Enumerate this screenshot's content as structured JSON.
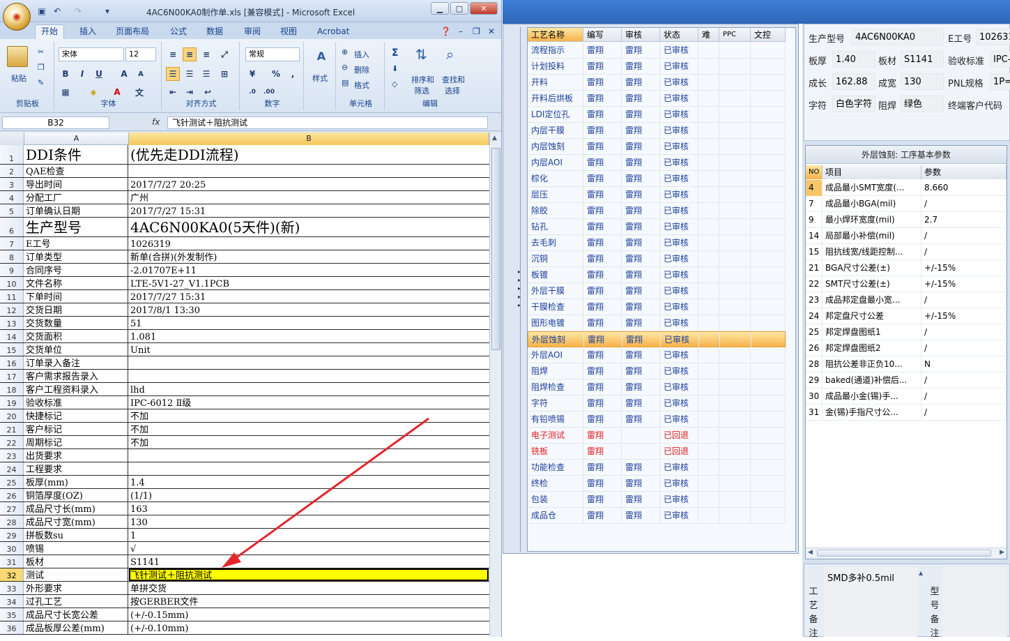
{
  "excel": {
    "window_title": "4AC6N00KA0制作单.xls  [兼容模式] - Microsoft Excel",
    "tabs": [
      "开始",
      "插入",
      "页面布局",
      "公式",
      "数据",
      "审阅",
      "视图",
      "Acrobat"
    ],
    "ribbon": {
      "clipboard": {
        "paste": "粘贴",
        "group": "剪贴板"
      },
      "font": {
        "name": "宋体",
        "size": "12",
        "group": "字体"
      },
      "align": {
        "group": "对齐方式"
      },
      "number": {
        "format": "常规",
        "group": "数字"
      },
      "styles": {
        "label": "样式"
      },
      "cells": {
        "insert": "插入",
        "delete": "删除",
        "format": "格式",
        "group": "单元格"
      },
      "editing": {
        "sort": "排序和",
        "sort2": "筛选",
        "find": "查找和",
        "find2": "选择",
        "group": "编辑"
      }
    },
    "name_box": "B32",
    "fx": "fx",
    "formula": "飞针测试＋阻抗测试",
    "col_a": "A",
    "col_b": "B",
    "rows": [
      {
        "n": "1",
        "a": "DDI条件",
        "b": "(优先走DDI流程)"
      },
      {
        "n": "2",
        "a": "QAE检查",
        "b": ""
      },
      {
        "n": "3",
        "a": "导出时间",
        "b": "2017/7/27 20:25"
      },
      {
        "n": "4",
        "a": "分配工厂",
        "b": "广州"
      },
      {
        "n": "5",
        "a": "订单确认日期",
        "b": "2017/7/27 15:31"
      },
      {
        "n": "6",
        "a": "生产型号",
        "b": "4AC6N00KA0(5天件)(新)"
      },
      {
        "n": "7",
        "a": "E工号",
        "b": "1026319"
      },
      {
        "n": "8",
        "a": "订单类型",
        "b": "新单(合拼)(外发制作)"
      },
      {
        "n": "9",
        "a": "合同序号",
        "b": "-2.01707E+11"
      },
      {
        "n": "10",
        "a": "文件名称",
        "b": "LTE-5V1-27_V1.1PCB"
      },
      {
        "n": "11",
        "a": "下单时间",
        "b": "2017/7/27 15:31"
      },
      {
        "n": "12",
        "a": "交货日期",
        "b": "2017/8/1 13:30"
      },
      {
        "n": "13",
        "a": "交货数量",
        "b": "51"
      },
      {
        "n": "14",
        "a": "交货面积",
        "b": "1.081"
      },
      {
        "n": "15",
        "a": "交货单位",
        "b": "Unit"
      },
      {
        "n": "16",
        "a": "订单录入备注",
        "b": ""
      },
      {
        "n": "17",
        "a": "客户需求报告录入",
        "b": ""
      },
      {
        "n": "18",
        "a": "客户工程资料录入",
        "b": "lhd"
      },
      {
        "n": "19",
        "a": "验收标准",
        "b": "IPC-6012 Ⅱ级"
      },
      {
        "n": "20",
        "a": "快捷标记",
        "b": "不加"
      },
      {
        "n": "21",
        "a": "客户标记",
        "b": "不加"
      },
      {
        "n": "22",
        "a": "周期标记",
        "b": "不加"
      },
      {
        "n": "23",
        "a": "出货要求",
        "b": ""
      },
      {
        "n": "24",
        "a": "工程要求",
        "b": ""
      },
      {
        "n": "25",
        "a": "板厚(mm)",
        "b": "1.4"
      },
      {
        "n": "26",
        "a": "铜箔厚度(OZ)",
        "b": " (1/1)"
      },
      {
        "n": "27",
        "a": "成品尺寸长(mm)",
        "b": "163"
      },
      {
        "n": "28",
        "a": "成品尺寸宽(mm)",
        "b": "130"
      },
      {
        "n": "29",
        "a": "拼板数su",
        "b": "1"
      },
      {
        "n": "30",
        "a": "喷锡",
        "b": " √"
      },
      {
        "n": "31",
        "a": "板材",
        "b": "S1141"
      },
      {
        "n": "32",
        "a": "测试",
        "b": "飞针测试＋阻抗测试"
      },
      {
        "n": "33",
        "a": "外形要求",
        "b": "单拼交货"
      },
      {
        "n": "34",
        "a": "过孔工艺",
        "b": "按GERBER文件"
      },
      {
        "n": "35",
        "a": "成品尺寸长宽公差",
        "b": "(+/-0.15mm)"
      },
      {
        "n": "36",
        "a": "成品板厚公差(mm)",
        "b": "(+/-0.10mm)"
      }
    ]
  },
  "process": {
    "headers": [
      "工艺名称",
      "编写",
      "审核",
      "状态",
      "难",
      "PPC",
      "文控"
    ],
    "rows": [
      {
        "name": "流程指示",
        "writer": "雷翔",
        "reviewer": "雷翔",
        "status": "已审核"
      },
      {
        "name": "计划投料",
        "writer": "雷翔",
        "reviewer": "雷翔",
        "status": "已审核"
      },
      {
        "name": "开料",
        "writer": "雷翔",
        "reviewer": "雷翔",
        "status": "已审核"
      },
      {
        "name": "开料后烘板",
        "writer": "雷翔",
        "reviewer": "雷翔",
        "status": "已审核"
      },
      {
        "name": "LDI定位孔",
        "writer": "雷翔",
        "reviewer": "雷翔",
        "status": "已审核"
      },
      {
        "name": "内层干膜",
        "writer": "雷翔",
        "reviewer": "雷翔",
        "status": "已审核"
      },
      {
        "name": "内层蚀刻",
        "writer": "雷翔",
        "reviewer": "雷翔",
        "status": "已审核"
      },
      {
        "name": "内层AOI",
        "writer": "雷翔",
        "reviewer": "雷翔",
        "status": "已审核"
      },
      {
        "name": "棕化",
        "writer": "雷翔",
        "reviewer": "雷翔",
        "status": "已审核"
      },
      {
        "name": "层压",
        "writer": "雷翔",
        "reviewer": "雷翔",
        "status": "已审核"
      },
      {
        "name": "除胶",
        "writer": "雷翔",
        "reviewer": "雷翔",
        "status": "已审核"
      },
      {
        "name": "钻孔",
        "writer": "雷翔",
        "reviewer": "雷翔",
        "status": "已审核"
      },
      {
        "name": "去毛刺",
        "writer": "雷翔",
        "reviewer": "雷翔",
        "status": "已审核"
      },
      {
        "name": "沉铜",
        "writer": "雷翔",
        "reviewer": "雷翔",
        "status": "已审核"
      },
      {
        "name": "板镀",
        "writer": "雷翔",
        "reviewer": "雷翔",
        "status": "已审核"
      },
      {
        "name": "外层干膜",
        "writer": "雷翔",
        "reviewer": "雷翔",
        "status": "已审核"
      },
      {
        "name": "干膜检查",
        "writer": "雷翔",
        "reviewer": "雷翔",
        "status": "已审核"
      },
      {
        "name": "图形电镀",
        "writer": "雷翔",
        "reviewer": "雷翔",
        "status": "已审核"
      },
      {
        "name": "外层蚀刻",
        "writer": "雷翔",
        "reviewer": "雷翔",
        "status": "已审核"
      },
      {
        "name": "外层AOI",
        "writer": "雷翔",
        "reviewer": "雷翔",
        "status": "已审核"
      },
      {
        "name": "阻焊",
        "writer": "雷翔",
        "reviewer": "雷翔",
        "status": "已审核"
      },
      {
        "name": "阻焊检查",
        "writer": "雷翔",
        "reviewer": "雷翔",
        "status": "已审核"
      },
      {
        "name": "字符",
        "writer": "雷翔",
        "reviewer": "雷翔",
        "status": "已审核"
      },
      {
        "name": "有铅喷锡",
        "writer": "雷翔",
        "reviewer": "雷翔",
        "status": "已审核"
      },
      {
        "name": "电子测试",
        "writer": "雷翔",
        "reviewer": "",
        "status": "已回退"
      },
      {
        "name": "铣板",
        "writer": "雷翔",
        "reviewer": "",
        "status": "已回退"
      },
      {
        "name": "功能检查",
        "writer": "雷翔",
        "reviewer": "雷翔",
        "status": "已审核"
      },
      {
        "name": "终检",
        "writer": "雷翔",
        "reviewer": "雷翔",
        "status": "已审核"
      },
      {
        "name": "包装",
        "writer": "雷翔",
        "reviewer": "雷翔",
        "status": "已审核"
      },
      {
        "name": "成品仓",
        "writer": "雷翔",
        "reviewer": "雷翔",
        "status": "已审核"
      }
    ]
  },
  "info": {
    "model_label": "生产型号",
    "model": "4AC6N00KA0",
    "eno_label": "E工号",
    "eno": "102631",
    "thick_label": "板厚",
    "thick": "1.40",
    "material_label": "板材",
    "material": "S1141",
    "std_label": "验收标准",
    "std": "IPC-",
    "len_label": "成长",
    "len": "162.88",
    "wid_label": "成宽",
    "wid": "130",
    "pnl_label": "PNL规格",
    "pnl": "1P=",
    "char_label": "字符",
    "char": "白色字符",
    "mask_label": "阻焊",
    "mask": "绿色",
    "cust_label": "终端客户代码"
  },
  "params": {
    "title": "外层蚀刻: 工序基本参数",
    "headers": [
      "NO",
      "项目",
      "参数"
    ],
    "rows": [
      {
        "no": "4",
        "item": "成品最小SMT宽度(...",
        "val": "8.660"
      },
      {
        "no": "7",
        "item": "成品最小BGA(mil)",
        "val": "/"
      },
      {
        "no": "9",
        "item": "最小焊环宽度(mil)",
        "val": "2.7"
      },
      {
        "no": "14",
        "item": "局部最小补偿(mil)",
        "val": "/"
      },
      {
        "no": "15",
        "item": "阻抗线宽/线距控制...",
        "val": "/"
      },
      {
        "no": "21",
        "item": "BGA尺寸公差(±)",
        "val": "+/-15%"
      },
      {
        "no": "22",
        "item": "SMT尺寸公差(±)",
        "val": "+/-15%"
      },
      {
        "no": "23",
        "item": "成品邦定盘最小宽...",
        "val": "/"
      },
      {
        "no": "24",
        "item": "邦定盘尺寸公差",
        "val": "+/-15%"
      },
      {
        "no": "25",
        "item": "邦定焊盘图纸1",
        "val": "/"
      },
      {
        "no": "26",
        "item": "邦定焊盘图纸2",
        "val": "/"
      },
      {
        "no": "28",
        "item": "阻抗公差非正负10...",
        "val": "N"
      },
      {
        "no": "29",
        "item": "baked(通道)补偿后...",
        "val": "/"
      },
      {
        "no": "30",
        "item": "成品最小金(锡)手...",
        "val": "/"
      },
      {
        "no": "31",
        "item": "金(锡)手指尺寸公...",
        "val": "/"
      }
    ]
  },
  "notes": {
    "process_note_label": "工艺备注",
    "process_note": "SMD多补0.5mil",
    "model_note_label": "型号备注"
  }
}
